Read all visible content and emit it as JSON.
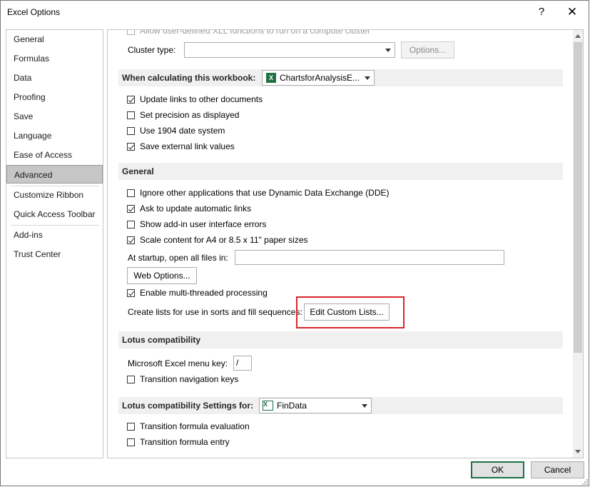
{
  "window": {
    "title": "Excel Options",
    "help": "?",
    "close": "✕"
  },
  "nav": {
    "items": [
      "General",
      "Formulas",
      "Data",
      "Proofing",
      "Save",
      "Language",
      "Ease of Access",
      "Advanced",
      "Customize Ribbon",
      "Quick Access Toolbar",
      "Add-ins",
      "Trust Center"
    ],
    "selected": "Advanced"
  },
  "cluster": {
    "partial_label": "Allow user-defined XLL functions to run on a compute cluster",
    "type_label": "Cluster type:",
    "options_button": "Options..."
  },
  "when_calculating": {
    "header": "When calculating this workbook:",
    "workbook": "ChartsforAnalysisE...",
    "options": [
      {
        "label": "Update links to other documents",
        "checked": true
      },
      {
        "label": "Set precision as displayed",
        "checked": false
      },
      {
        "label": "Use 1904 date system",
        "checked": false
      },
      {
        "label": "Save external link values",
        "checked": true
      }
    ]
  },
  "general": {
    "header": "General",
    "options": [
      {
        "label": "Ignore other applications that use Dynamic Data Exchange (DDE)",
        "checked": false
      },
      {
        "label": "Ask to update automatic links",
        "checked": true
      },
      {
        "label": "Show add-in user interface errors",
        "checked": false
      },
      {
        "label": "Scale content for A4 or 8.5 x 11\" paper sizes",
        "checked": true
      }
    ],
    "startup_label": "At startup, open all files in:",
    "startup_value": "",
    "web_options_button": "Web Options...",
    "multithread": {
      "label": "Enable multi-threaded processing",
      "checked": true
    },
    "custom_lists_label": "Create lists for use in sorts and fill sequences:",
    "custom_lists_button": "Edit Custom Lists..."
  },
  "lotus": {
    "header": "Lotus compatibility",
    "menu_key_label": "Microsoft Excel menu key:",
    "menu_key_value": "/",
    "nav_keys": {
      "label": "Transition navigation keys",
      "checked": false
    }
  },
  "lotus_settings": {
    "header": "Lotus compatibility Settings for:",
    "sheet": "FinData",
    "options": [
      {
        "label": "Transition formula evaluation",
        "checked": false
      },
      {
        "label": "Transition formula entry",
        "checked": false
      }
    ]
  },
  "footer": {
    "ok": "OK",
    "cancel": "Cancel"
  },
  "colors": {
    "highlight": "#d9252c",
    "excel_green": "#1e7145",
    "nav_selected": "#c6c6c6"
  }
}
